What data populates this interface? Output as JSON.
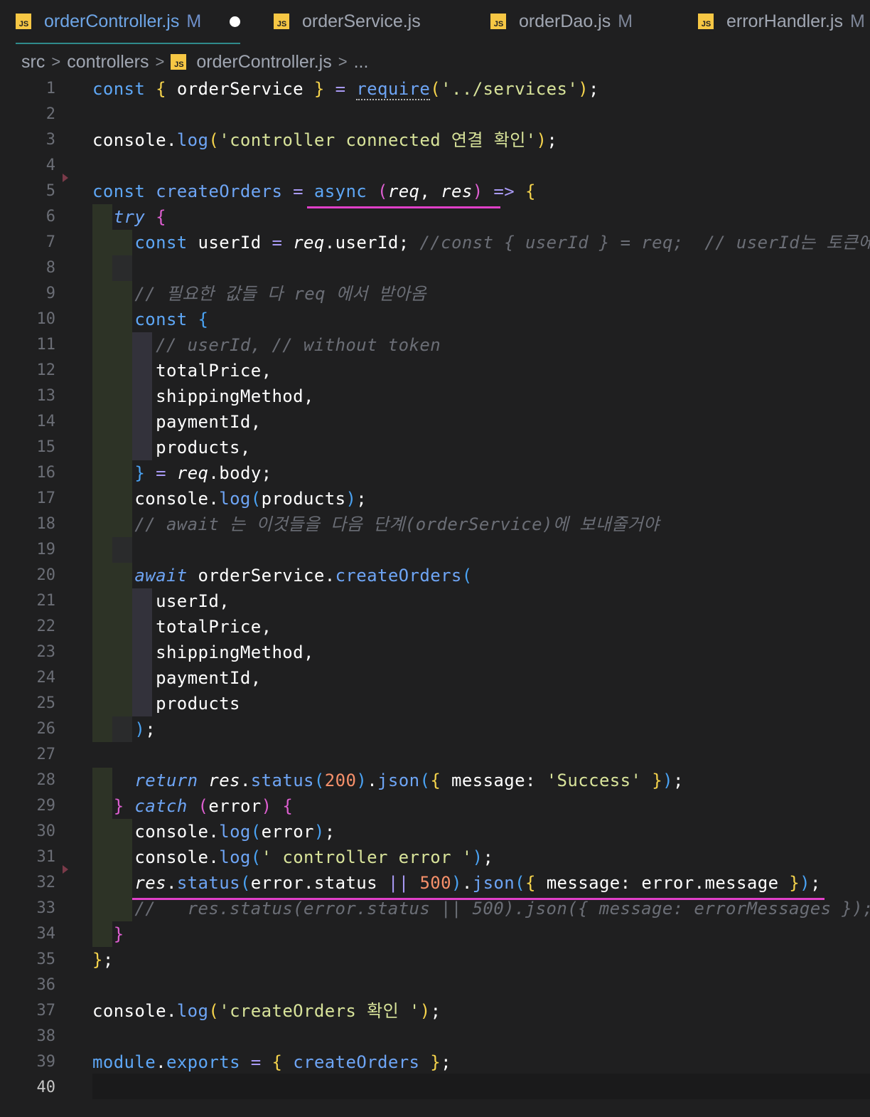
{
  "tabs": [
    {
      "name": "orderController.js",
      "modified": "M",
      "badge": "JS"
    },
    {
      "name": "orderService.js",
      "modified": "",
      "badge": "JS"
    },
    {
      "name": "orderDao.js",
      "modified": "M",
      "badge": "JS"
    },
    {
      "name": "errorHandler.js",
      "modified": "M",
      "badge": "JS"
    }
  ],
  "breadcrumb": {
    "items": [
      "src",
      "controllers",
      "orderController.js",
      "..."
    ],
    "separator": ">",
    "badge": "JS"
  },
  "editor": {
    "current_line": 40,
    "line_numbers": [
      "1",
      "2",
      "3",
      "4",
      "5",
      "6",
      "7",
      "8",
      "9",
      "10",
      "11",
      "12",
      "13",
      "14",
      "15",
      "16",
      "17",
      "18",
      "19",
      "20",
      "21",
      "22",
      "23",
      "24",
      "25",
      "26",
      "27",
      "28",
      "29",
      "30",
      "31",
      "32",
      "33",
      "34",
      "35",
      "36",
      "37",
      "38",
      "39",
      "40"
    ],
    "code": {
      "l1": {
        "const": "const",
        "ob": "{",
        "name": "orderService",
        "cb": "}",
        "eq": "=",
        "req": "require",
        "po": "(",
        "str": "'../services'",
        "pc": ")",
        "semi": ";"
      },
      "l3": {
        "obj": "console",
        "dot": ".",
        "fn": "log",
        "po": "(",
        "str": "'controller connected 연결 확인'",
        "pc": ")",
        "semi": ";"
      },
      "l5": {
        "const": "const",
        "name": "createOrders",
        "eq": "=",
        "async": "async",
        "po": "(",
        "p1": "req",
        "comma": ",",
        "p2": "res",
        "pc": ")",
        "arrow": "=>",
        "ob": "{"
      },
      "l6": {
        "try": "try",
        "ob": "{"
      },
      "l7": {
        "const": "const",
        "name": "userId",
        "eq": "=",
        "obj": "req",
        "dot": ".",
        "prop": "userId",
        "semi": ";",
        "comment": "//const { userId } = req;  // userId는 토큰에서"
      },
      "l9": {
        "comment": "// 필요한 값들 다 req 에서 받아옴"
      },
      "l10": {
        "const": "const",
        "ob": "{"
      },
      "l11": {
        "comment": "// userId, // without token"
      },
      "l12": {
        "name": "totalPrice",
        "comma": ","
      },
      "l13": {
        "name": "shippingMethod",
        "comma": ","
      },
      "l14": {
        "name": "paymentId",
        "comma": ","
      },
      "l15": {
        "name": "products",
        "comma": ","
      },
      "l16": {
        "cb": "}",
        "eq": "=",
        "obj": "req",
        "dot": ".",
        "prop": "body",
        "semi": ";"
      },
      "l17": {
        "obj": "console",
        "dot": ".",
        "fn": "log",
        "po": "(",
        "arg": "products",
        "pc": ")",
        "semi": ";"
      },
      "l18": {
        "comment": "// await 는 이것들을 다음 단계(orderService)에 보내줄거야"
      },
      "l20": {
        "await": "await",
        "obj": "orderService",
        "dot": ".",
        "fn": "createOrders",
        "po": "("
      },
      "l21": {
        "name": "userId",
        "comma": ","
      },
      "l22": {
        "name": "totalPrice",
        "comma": ","
      },
      "l23": {
        "name": "shippingMethod",
        "comma": ","
      },
      "l24": {
        "name": "paymentId",
        "comma": ","
      },
      "l25": {
        "name": "products"
      },
      "l26": {
        "pc": ")",
        "semi": ";"
      },
      "l28": {
        "ret": "return",
        "obj": "res",
        "dot": ".",
        "fn": "status",
        "po": "(",
        "num": "200",
        "pc": ")",
        "dot2": ".",
        "fn2": "json",
        "po2": "(",
        "ob": "{",
        "key": "message",
        "colon": ":",
        "str": "'Success'",
        "cb": "}",
        "pc2": ")",
        "semi": ";"
      },
      "l29": {
        "cb": "}",
        "catch": "catch",
        "po": "(",
        "arg": "error",
        "pc": ")",
        "ob": "{"
      },
      "l30": {
        "obj": "console",
        "dot": ".",
        "fn": "log",
        "po": "(",
        "arg": "error",
        "pc": ")",
        "semi": ";"
      },
      "l31": {
        "obj": "console",
        "dot": ".",
        "fn": "log",
        "po": "(",
        "str": "' controller error '",
        "pc": ")",
        "semi": ";"
      },
      "l32": {
        "obj": "res",
        "dot": ".",
        "fn": "status",
        "po": "(",
        "a1": "error",
        "dot2": ".",
        "a2": "status",
        "or": "||",
        "num": "500",
        "pc": ")",
        "dot3": ".",
        "fn2": "json",
        "po2": "(",
        "ob": "{",
        "key": "message",
        "colon": ":",
        "a3": "error",
        "dot4": ".",
        "a4": "message",
        "cb": "}",
        "pc2": ")",
        "semi": ";"
      },
      "l33": {
        "comment": "//   res.status(error.status || 500).json({ message: errorMessages });"
      },
      "l34": {
        "cb": "}"
      },
      "l35": {
        "cb": "}",
        "semi": ";"
      },
      "l37": {
        "obj": "console",
        "dot": ".",
        "fn": "log",
        "po": "(",
        "str": "'createOrders 확인 '",
        "pc": ")",
        "semi": ";"
      },
      "l39": {
        "obj": "module",
        "dot": ".",
        "prop": "exports",
        "eq": "=",
        "ob": "{",
        "name": "createOrders",
        "cb": "}",
        "semi": ";"
      }
    }
  },
  "colors": {
    "background": "#1f1f20",
    "keyword": "#5ea7f6",
    "string": "#d8e39a",
    "number": "#f6906a",
    "comment": "#6b6e76",
    "active_tab_border": "#2f8b8c",
    "highlight_underline": "#e040c8"
  },
  "icons": {
    "tab_file_icon": "js-file-icon",
    "dirty_indicator": "unsaved-dot-icon",
    "fold_marker": "fold-triangle-icon"
  }
}
